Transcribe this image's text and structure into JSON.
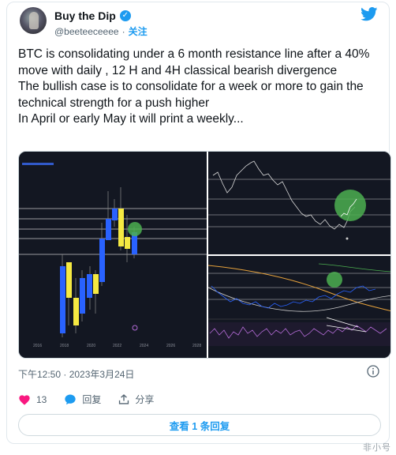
{
  "author": {
    "name": "Buy the Dip",
    "handle": "@beeteeceeee",
    "handle_separator": "·",
    "follow_label": "关注"
  },
  "icons": {
    "verified": "verified-badge-icon",
    "brand": "twitter-bird-icon",
    "info": "info-icon",
    "like": "heart-icon",
    "reply": "speech-bubble-icon",
    "share": "share-upload-icon"
  },
  "colors": {
    "accent": "#1d9bf0",
    "like": "#f91880",
    "chart_bg": "#131722",
    "candle_up": "#2962ff",
    "candle_down": "#f5e942",
    "highlight": "#4caf50"
  },
  "tweet": {
    "lines": [
      "BTC is consolidating under a 6 month resistance line after a 40% move with daily , 12 H and 4H classical bearish divergence",
      "The bullish case is to consolidate for a week or more to  gain the technical strength for a push higher",
      "In April or early May it will print a weekly..."
    ]
  },
  "media": {
    "left_chart_years": [
      "2016",
      "2018",
      "2020",
      "2022",
      "2024",
      "2026",
      "2028"
    ]
  },
  "timestamp": "下午12:50 · 2023年3月24日",
  "actions": {
    "likes_count": "13",
    "reply_label": "回复",
    "share_label": "分享"
  },
  "view_replies_label": "查看 1 条回复",
  "watermark": "非小号"
}
